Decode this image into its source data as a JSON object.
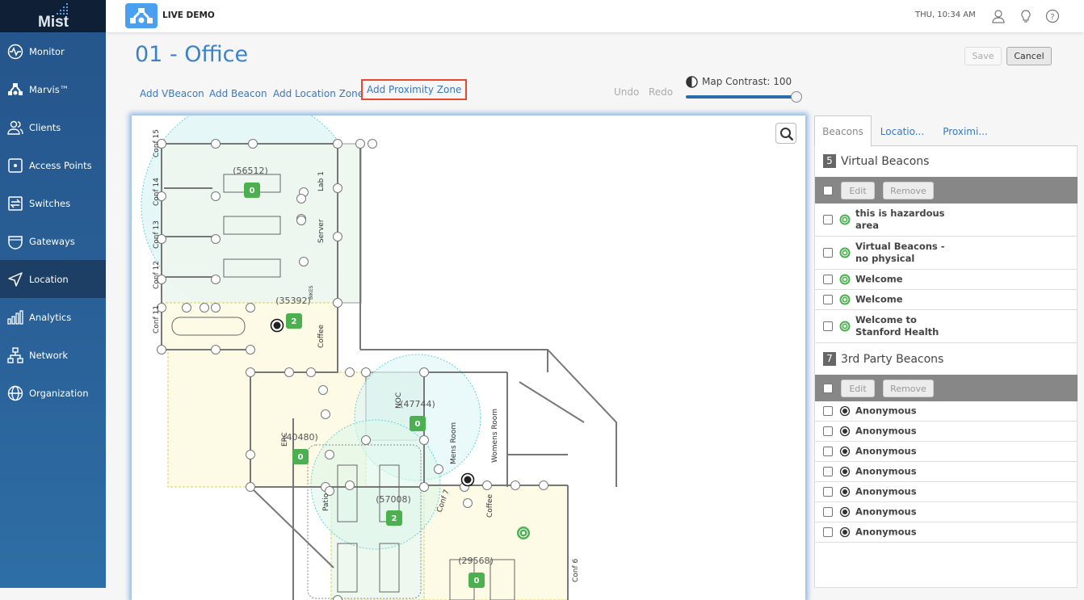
{
  "brand": {
    "logo": "Mist",
    "live_label": "LIVE DEMO"
  },
  "sidebar": {
    "items": [
      {
        "label": "Monitor",
        "icon": "monitor-icon"
      },
      {
        "label": "Marvis™",
        "icon": "marvis-icon"
      },
      {
        "label": "Clients",
        "icon": "clients-icon"
      },
      {
        "label": "Access Points",
        "icon": "access-point-icon"
      },
      {
        "label": "Switches",
        "icon": "switch-icon"
      },
      {
        "label": "Gateways",
        "icon": "gateway-icon"
      },
      {
        "label": "Location",
        "icon": "location-icon",
        "active": true
      },
      {
        "label": "Analytics",
        "icon": "analytics-icon"
      },
      {
        "label": "Network",
        "icon": "network-icon"
      },
      {
        "label": "Organization",
        "icon": "globe-icon"
      }
    ]
  },
  "header": {
    "datetime": "THU, 10:34 AM"
  },
  "page": {
    "title": "01 - Office",
    "save": "Save",
    "cancel": "Cancel"
  },
  "toolbar": {
    "add_vbeacon": "Add VBeacon",
    "add_beacon": "Add Beacon",
    "add_location_zone": "Add Location Zone",
    "add_proximity_zone": "Add Proximity Zone",
    "undo": "Undo",
    "redo": "Redo",
    "contrast_label": "Map Contrast: 100",
    "contrast_value": 100
  },
  "map": {
    "zones": [
      {
        "id": "(56512)",
        "count": "0"
      },
      {
        "id": "(35392)",
        "count": "2"
      },
      {
        "id": "(47744)",
        "count": "0"
      },
      {
        "id": "(40480)",
        "count": "0"
      },
      {
        "id": "(57008)",
        "count": "2"
      },
      {
        "id": "(29568)",
        "count": "0"
      }
    ],
    "rooms": [
      "Conf 15",
      "Conf 14",
      "Conf 13",
      "Conf 12",
      "Conf 11",
      "Lab 1",
      "Server",
      "Coffee",
      "NOC",
      "Mens Room",
      "Womens Room",
      "Patio",
      "Conf 7",
      "Coffee",
      "Conf 6",
      "ERC",
      "BIKES"
    ]
  },
  "panel": {
    "tabs": [
      "Beacons",
      "Locatio...",
      "Proximi..."
    ],
    "virtual": {
      "count": "5",
      "title": "Virtual Beacons",
      "edit": "Edit",
      "remove": "Remove",
      "items": [
        "this is hazardous area",
        "Virtual Beacons - no physical",
        "Welcome",
        "Welcome",
        "Welcome to Stanford Health"
      ]
    },
    "third_party": {
      "count": "7",
      "title": "3rd Party Beacons",
      "edit": "Edit",
      "remove": "Remove",
      "items": [
        "Anonymous",
        "Anonymous",
        "Anonymous",
        "Anonymous",
        "Anonymous",
        "Anonymous",
        "Anonymous"
      ]
    }
  },
  "colors": {
    "accent": "#3c82c8",
    "sidebar": "#2a6299",
    "badge": "#4caf50",
    "highlight": "#e8492e"
  }
}
